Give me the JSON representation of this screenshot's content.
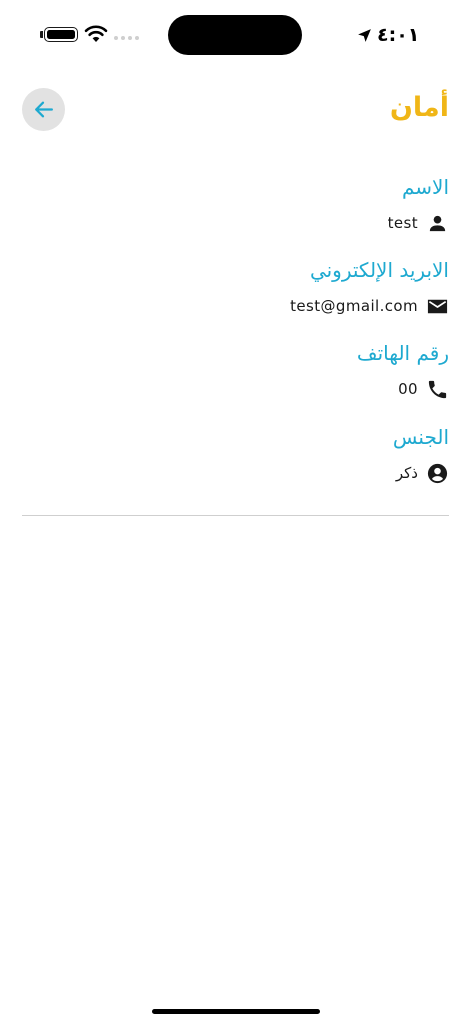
{
  "status_bar": {
    "time": "٤:٠١",
    "battery_level": 1.0,
    "icons": [
      "battery-icon",
      "wifi-icon",
      "cellular-signal-icon",
      "location-arrow-icon"
    ]
  },
  "header": {
    "title": "أمان",
    "back_icon": "arrow-left-icon"
  },
  "colors": {
    "title": "#f0b617",
    "label": "#1ea9d0",
    "value": "#1a1a1a",
    "back_button_bg": "#e2e2e2",
    "back_arrow": "#1ea9d0"
  },
  "profile": {
    "name": {
      "label": "الاسم",
      "value": "test",
      "icon": "person-icon"
    },
    "email": {
      "label": "الابريد الإلكتروني",
      "value": "test@gmail.com",
      "icon": "mail-icon"
    },
    "phone": {
      "label": "رقم الهاتف",
      "value": "00",
      "icon": "phone-icon"
    },
    "gender": {
      "label": "الجنس",
      "value": "ذكر",
      "icon": "account-circle-icon"
    }
  }
}
